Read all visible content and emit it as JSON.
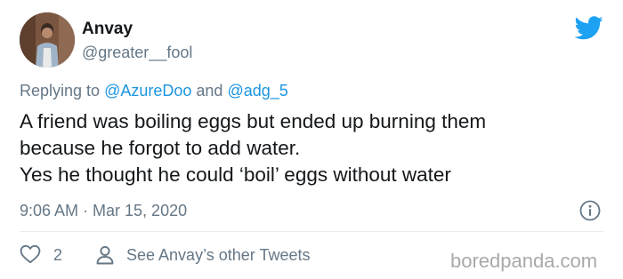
{
  "author": {
    "display_name": "Anvay",
    "handle": "@greater__fool"
  },
  "reply": {
    "prefix": "Replying to ",
    "mention_1": "@AzureDoo",
    "joiner": " and ",
    "mention_2": "@adg_5"
  },
  "tweet": {
    "lines": [
      "A friend was boiling eggs but ended up burning them",
      "because he forgot to add water.",
      "Yes he thought he could ‘boil’ eggs without water"
    ]
  },
  "meta": {
    "timestamp": "9:06 AM · Mar 15, 2020"
  },
  "actions": {
    "like_count": "2",
    "other_tweets_label": "See Anvay’s other Tweets"
  },
  "watermark": "boredpanda.com",
  "icons": {
    "brand": "twitter-bird-icon",
    "info": "info-icon",
    "like": "heart-icon",
    "profile": "person-icon"
  },
  "colors": {
    "twitter_blue": "#1da1f2",
    "mention_blue": "#1b95e0",
    "secondary_text": "#657786",
    "primary_text": "#14171a",
    "divider": "#e6ecf0",
    "watermark": "#a9a9a9"
  }
}
